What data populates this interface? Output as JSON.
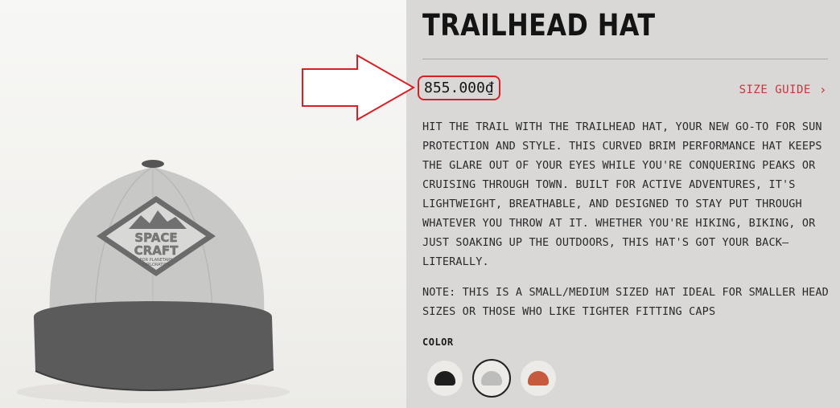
{
  "product": {
    "title": "TRAILHEAD HAT",
    "price": "855.000₫",
    "size_guide_label": "SIZE GUIDE",
    "description": "HIT THE TRAIL WITH THE TRAILHEAD HAT, YOUR NEW GO-TO FOR SUN PROTECTION AND STYLE. THIS CURVED BRIM PERFORMANCE HAT KEEPS THE GLARE OUT OF YOUR EYES WHILE YOU'RE CONQUERING PEAKS OR CRUISING THROUGH TOWN. BUILT FOR ACTIVE ADVENTURES, IT'S LIGHTWEIGHT, BREATHABLE, AND DESIGNED TO STAY PUT THROUGH WHATEVER YOU THROW AT IT. WHETHER YOU'RE HIKING, BIKING, OR JUST SOAKING UP THE OUTDOORS, THIS HAT'S GOT YOUR BACK—LITERALLY.",
    "note": "NOTE: THIS IS A SMALL/MEDIUM SIZED HAT IDEAL FOR SMALLER HEAD SIZES OR THOSE WHO LIKE TIGHTER FITTING CAPS",
    "color_label": "COLOR",
    "colors": [
      {
        "name": "black",
        "hex": "#1e1e1e",
        "selected": false
      },
      {
        "name": "grey",
        "hex": "#bdbdbb",
        "selected": true
      },
      {
        "name": "rust",
        "hex": "#c55a3e",
        "selected": false
      }
    ],
    "image": {
      "patch_line1": "SPACE",
      "patch_line2": "CRAFT",
      "patch_line3": "FOR PLANETARY",
      "patch_line4": "EXPLORATION"
    }
  },
  "annotation": {
    "color": "#d81f26",
    "icon": "arrow-right-icon"
  }
}
